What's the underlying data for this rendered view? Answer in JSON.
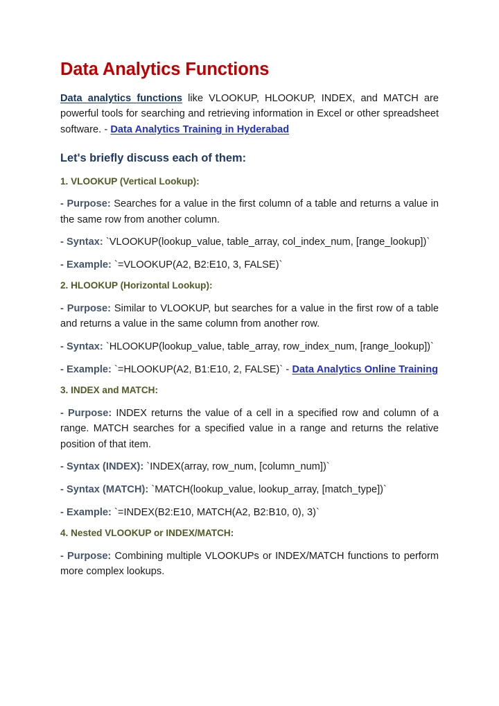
{
  "document": {
    "title": "Data Analytics Functions",
    "title_color": "#C00000",
    "link_navy_color": "#17375E",
    "link_blue_color": "#2030C8",
    "heading_navy_color": "#1F3864",
    "heading_olive_color": "#4E5B25",
    "label_slate_color": "#44546A",
    "body_color": "#1a1a1a",
    "background_color": "#FFFFFF"
  },
  "intro": {
    "link_text": "Data analytics functions",
    "body_before_link2": " like VLOOKUP, HLOOKUP, INDEX, and MATCH are powerful tools for searching and retrieving information in Excel or other spreadsheet software. - ",
    "link2_text": "Data Analytics Training in Hyderabad"
  },
  "lead_heading": "Let's briefly discuss each of them:",
  "sections": [
    {
      "heading": "1. VLOOKUP (Vertical Lookup):",
      "purpose_label": " - Purpose:",
      "purpose_text": " Searches for a value in the first column of a table and returns a value in the same row from another column.",
      "syntax_label": "-        Syntax:",
      "syntax_text": "   `VLOOKUP(lookup_value,      table_array,     col_index_num, [range_lookup])`",
      "example_label": " - Example:",
      "example_text": " `=VLOOKUP(A2, B2:E10, 3, FALSE)`"
    },
    {
      "heading": "2. HLOOKUP (Horizontal Lookup):",
      "purpose_label": " - Purpose:",
      "purpose_text": " Similar to VLOOKUP, but searches for a value in the first row of a table and returns a value in the same column from another row.",
      "syntax_label": "-      Syntax:",
      "syntax_text": "   `HLOOKUP(lookup_value,      table_array,     row_index_num, [range_lookup])`",
      "example_label": " - Example:",
      "example_text": " `=HLOOKUP(A2, B1:E10, 2, FALSE)` - ",
      "example_link_text": "Data Analytics Online Training"
    },
    {
      "heading": "3. INDEX and MATCH:",
      "purpose_label": " - Purpose:",
      "purpose_text": " INDEX returns the value of a cell in a specified row and column of a range. MATCH searches for a specified value in a range and returns the relative position of that item.",
      "syntax_index_label": " - Syntax (INDEX):",
      "syntax_index_text": " `INDEX(array, row_num, [column_num])`",
      "syntax_match_label": " - Syntax (MATCH):",
      "syntax_match_text": " `MATCH(lookup_value, lookup_array, [match_type])`",
      "example_label": " - Example:",
      "example_text": " `=INDEX(B2:E10, MATCH(A2, B2:B10, 0), 3)`"
    },
    {
      "heading": "4. Nested VLOOKUP or INDEX/MATCH:",
      "purpose_label": " - Purpose:",
      "purpose_text": " Combining multiple VLOOKUPs or INDEX/MATCH functions to perform more complex lookups."
    }
  ]
}
